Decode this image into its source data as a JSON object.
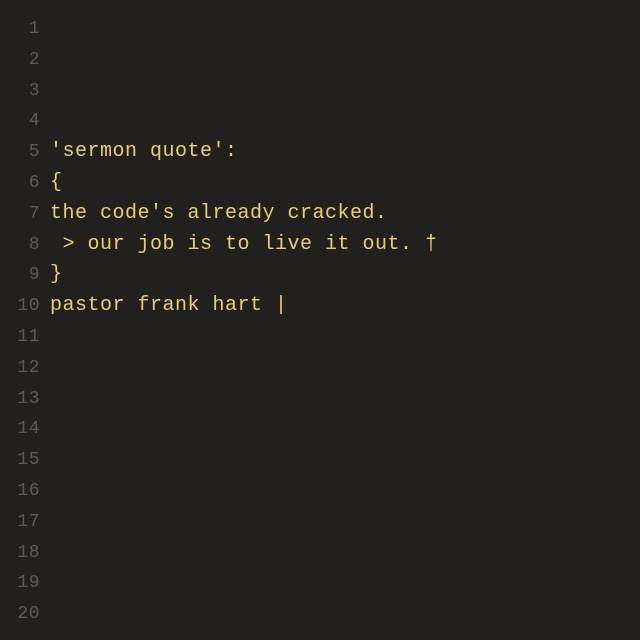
{
  "total_lines": 20,
  "colors": {
    "background": "#22201f",
    "gutter": "#5f5b54",
    "text": "#e9cf6f"
  },
  "lines": {
    "1": "",
    "2": "",
    "3": "",
    "4": "",
    "5": "'sermon quote':",
    "6": "{",
    "7": "the code's already cracked.",
    "8": " > our job is to live it out. †",
    "9": "}",
    "10": "pastor frank hart |",
    "11": "",
    "12": "",
    "13": "",
    "14": "",
    "15": "",
    "16": "",
    "17": "",
    "18": "",
    "19": "",
    "20": ""
  }
}
